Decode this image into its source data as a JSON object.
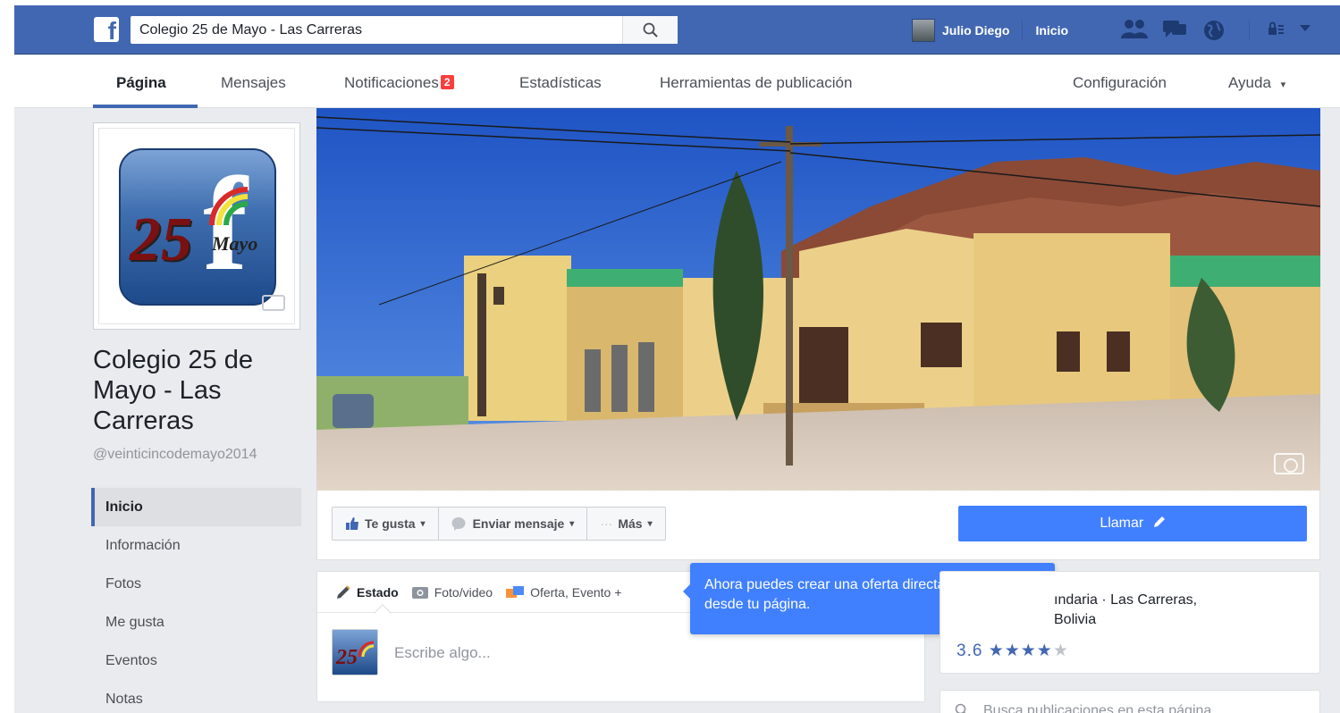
{
  "topbar": {
    "search_value": "Colegio 25 de Mayo - Las Carreras",
    "user_name": "Julio Diego",
    "home_label": "Inicio"
  },
  "page_tabs": {
    "pagina": "Página",
    "mensajes": "Mensajes",
    "notificaciones": "Notificaciones",
    "notificaciones_badge": "2",
    "estadisticas": "Estadísticas",
    "herramientas": "Herramientas de publicación",
    "configuracion": "Configuración",
    "ayuda": "Ayuda",
    "ayuda_caret": "▾"
  },
  "profile": {
    "name": "Colegio 25 de Mayo - Las Carreras",
    "handle": "@veinticincodemayo2014",
    "logo_number": "25",
    "logo_mayo": "Mayo"
  },
  "left_nav": [
    "Inicio",
    "Información",
    "Fotos",
    "Me gusta",
    "Eventos",
    "Notas"
  ],
  "actions": {
    "like": "Te gusta",
    "message": "Enviar mensaje",
    "more": "Más",
    "more_dots": "···",
    "caret": "▾",
    "call": "Llamar"
  },
  "composer": {
    "tabs": [
      "Estado",
      "Foto/video",
      "Oferta, Evento +"
    ],
    "placeholder": "Escribe algo..."
  },
  "tooltip": {
    "text": "Ahora puedes crear una oferta directamente desde tu página.",
    "close": "×"
  },
  "about": {
    "line1": "ındaria · Las Carreras,",
    "line2": "Bolivia",
    "rating_value": "3.6",
    "stars_filled": "★★★★",
    "stars_empty": "★",
    "rating_fraction": 0.72
  },
  "post_search": {
    "placeholder": "Busca publicaciones en esta página"
  },
  "colors": {
    "bluebar": "#4267b2",
    "accent": "#4080ff",
    "badge": "#fa3e3e",
    "background": "#e9ebee"
  },
  "icons": [
    "facebook-logo-icon",
    "search-icon",
    "friends-icon",
    "messages-icon",
    "globe-icon",
    "privacy-icon",
    "camera-icon",
    "like-icon",
    "messenger-icon",
    "pencil-icon",
    "photo-icon",
    "offer-icon",
    "close-icon"
  ]
}
